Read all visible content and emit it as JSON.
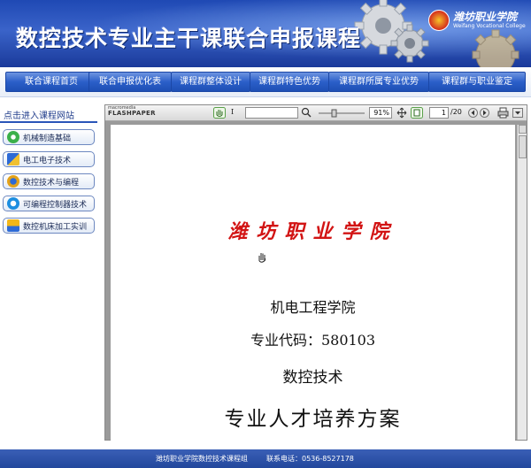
{
  "header": {
    "title": "数控技术专业主干课联合申报课程",
    "logo_cn": "潍坊职业学院",
    "logo_en": "Weifang Vocational College"
  },
  "nav": {
    "items": [
      {
        "label": "联合课程首页"
      },
      {
        "label": "联合申报优化表"
      },
      {
        "label": "课程群整体设计"
      },
      {
        "label": "课程群特色优势"
      },
      {
        "label": "课程群所属专业优势"
      },
      {
        "label": "课程群与职业鉴定"
      }
    ]
  },
  "sidebar": {
    "title": "点击进入课程网站",
    "items": [
      {
        "label": "机械制造基础",
        "icon": "gear-icon",
        "color": "#3bb04a"
      },
      {
        "label": "电工电子技术",
        "icon": "circuit-icon",
        "color": "#2d6ad6"
      },
      {
        "label": "数控技术与编程",
        "icon": "machine-icon",
        "color": "#e3a21a"
      },
      {
        "label": "可编程控制器技术",
        "icon": "controller-icon",
        "color": "#1d8ee0"
      },
      {
        "label": "数控机床加工实训",
        "icon": "lathe-icon",
        "color": "#f2b619"
      }
    ]
  },
  "viewer": {
    "brand_small": "macromedia",
    "brand_big": "FLASHPAPER",
    "zoom": "91%",
    "page_current": "1",
    "page_total": "/20",
    "search_value": ""
  },
  "document": {
    "school": "潍坊职业学院",
    "department": "机电工程学院",
    "code": "专业代码：580103",
    "major": "数控技术",
    "plan_title": "专业人才培养方案"
  },
  "footer": {
    "left": "潍坊职业学院数控技术课程组",
    "right": "联系电话：0536-8527178"
  },
  "colors": {
    "brand_blue": "#2b5fc9",
    "school_red": "#d21414"
  }
}
